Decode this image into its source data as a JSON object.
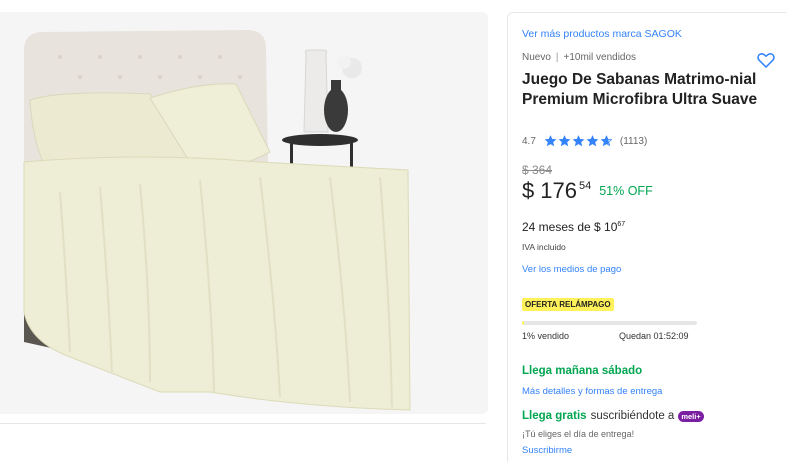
{
  "product": {
    "brand_link": "Ver más productos marca SAGOK",
    "condition": "Nuevo",
    "sold_count": "+10mil vendidos",
    "title": "Juego De Sabanas Matrimo-nial Premium Microfibra Ultra Suave",
    "rating": "4.7",
    "rating_value": 4.7,
    "review_count": "(1113)"
  },
  "price": {
    "original": "$ 364",
    "currency": "$",
    "amount": "176",
    "cents": "54",
    "discount": "51% OFF",
    "installments_prefix": "24 meses de $ 10",
    "installments_cents": "67",
    "tax_note": "IVA incluido",
    "payment_link": "Ver los medios de pago"
  },
  "flash_deal": {
    "badge": "OFERTA RELÁMPAGO",
    "sold_percent": 1,
    "sold_label": "1% vendido",
    "ends_label": "Quedan 01:52:09"
  },
  "shipping": {
    "arrival": "Llega mañana sábado",
    "details_link": "Más detalles y formas de entrega",
    "free_prefix": "Llega gratis",
    "free_suffix": "suscribiéndote a",
    "meli_badge": "meli+",
    "choose_day": "¡Tú eliges el día de entrega!",
    "subscribe_link": "Suscribirme"
  },
  "icons": {
    "favorite": "heart-icon",
    "star": "star-icon"
  },
  "colors": {
    "link": "#3483fa",
    "green": "#00a650",
    "flash_yellow": "#fff159",
    "meli_purple": "#7b1fa2"
  }
}
